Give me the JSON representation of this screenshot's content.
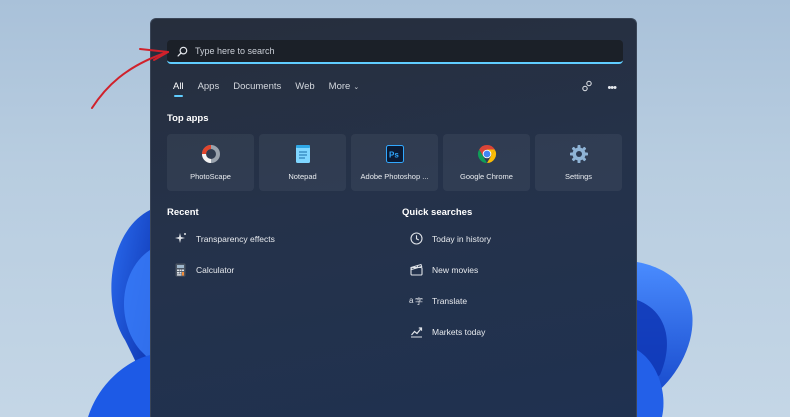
{
  "search": {
    "placeholder": "Type here to search"
  },
  "tabs": [
    {
      "label": "All",
      "active": true
    },
    {
      "label": "Apps"
    },
    {
      "label": "Documents"
    },
    {
      "label": "Web"
    },
    {
      "label": "More"
    }
  ],
  "top_apps": {
    "title": "Top apps",
    "items": [
      {
        "label": "PhotoScape",
        "icon": "photoscape-icon"
      },
      {
        "label": "Notepad",
        "icon": "notepad-icon"
      },
      {
        "label": "Adobe Photoshop ...",
        "icon": "photoshop-icon"
      },
      {
        "label": "Google Chrome",
        "icon": "chrome-icon"
      },
      {
        "label": "Settings",
        "icon": "gear-icon"
      }
    ]
  },
  "recent": {
    "title": "Recent",
    "items": [
      {
        "label": "Transparency effects",
        "icon": "sparkle-icon"
      },
      {
        "label": "Calculator",
        "icon": "calculator-icon"
      }
    ]
  },
  "quick_searches": {
    "title": "Quick searches",
    "items": [
      {
        "label": "Today in history",
        "icon": "clock-icon"
      },
      {
        "label": "New movies",
        "icon": "clapperboard-icon"
      },
      {
        "label": "Translate",
        "icon": "translate-icon"
      },
      {
        "label": "Markets today",
        "icon": "chart-icon"
      }
    ]
  },
  "colors": {
    "accent": "#60cdff",
    "annotation_arrow": "#d0212b",
    "panel": "#252f42"
  }
}
